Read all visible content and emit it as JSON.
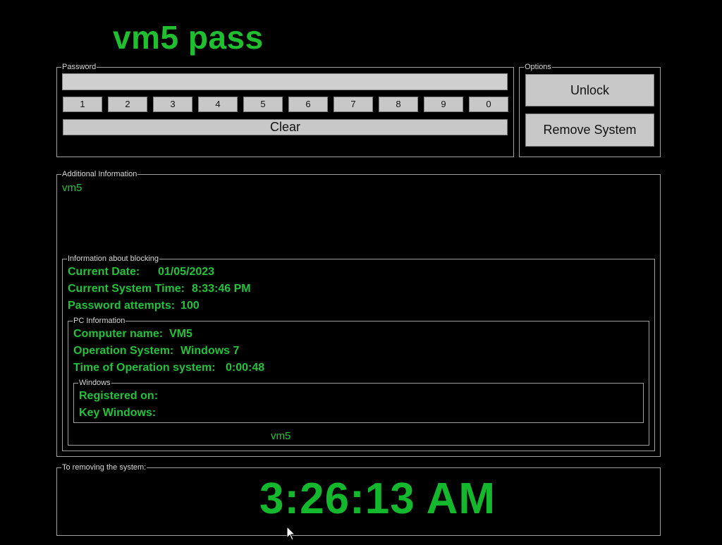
{
  "app": {
    "title": "vm5 pass"
  },
  "password_group": {
    "legend": "Password",
    "input_value": "",
    "digits": [
      "1",
      "2",
      "3",
      "4",
      "5",
      "6",
      "7",
      "8",
      "9",
      "0"
    ],
    "clear_label": "Clear"
  },
  "options_group": {
    "legend": "Options",
    "unlock_label": "Unlock",
    "remove_label": "Remove System"
  },
  "additional_info": {
    "legend": "Additional Information",
    "text": "vm5"
  },
  "blocking_info": {
    "legend": "Information about blocking",
    "current_date_label": "Current Date:",
    "current_date_value": "01/05/2023",
    "system_time_label": "Current System Time:",
    "system_time_value": "8:33:46 PM",
    "attempts_label": "Password attempts:",
    "attempts_value": "100"
  },
  "pc_info": {
    "legend": "PC Information",
    "computer_name_label": "Computer name:",
    "computer_name_value": "VM5",
    "os_label": "Operation System:",
    "os_value": "Windows 7",
    "os_time_label": "Time of Operation system:",
    "os_time_value": "0:00:48",
    "footer_text": "vm5"
  },
  "windows_info": {
    "legend": "Windows",
    "registered_label": "Registered on:",
    "key_label": "Key Windows:"
  },
  "removal": {
    "legend": "To removing the system:",
    "countdown": "3:26:13 AM"
  },
  "colors": {
    "background": "#000000",
    "text_green": "#22c33a",
    "button_gray": "#c8c8c8"
  }
}
